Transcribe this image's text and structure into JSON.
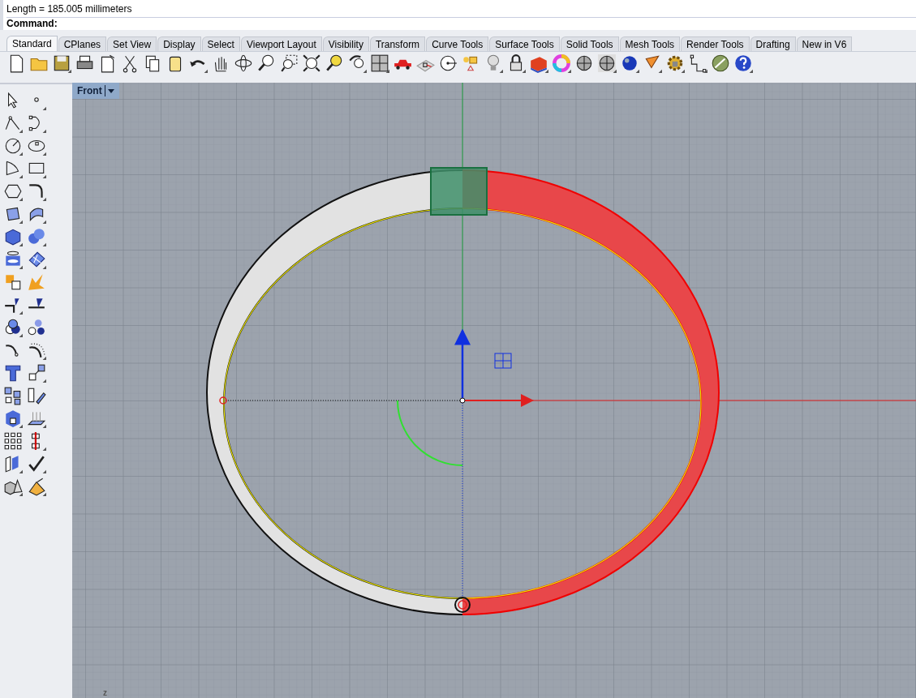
{
  "command_line": {
    "output": "Length = 185.005 millimeters",
    "prompt": "Command:"
  },
  "tabs": [
    {
      "label": "Standard",
      "selected": true
    },
    {
      "label": "CPlanes",
      "selected": false
    },
    {
      "label": "Set View",
      "selected": false
    },
    {
      "label": "Display",
      "selected": false
    },
    {
      "label": "Select",
      "selected": false
    },
    {
      "label": "Viewport Layout",
      "selected": false
    },
    {
      "label": "Visibility",
      "selected": false
    },
    {
      "label": "Transform",
      "selected": false
    },
    {
      "label": "Curve Tools",
      "selected": false
    },
    {
      "label": "Surface Tools",
      "selected": false
    },
    {
      "label": "Solid Tools",
      "selected": false
    },
    {
      "label": "Mesh Tools",
      "selected": false
    },
    {
      "label": "Render Tools",
      "selected": false
    },
    {
      "label": "Drafting",
      "selected": false
    },
    {
      "label": "New in V6",
      "selected": false
    }
  ],
  "viewport": {
    "title": "Front",
    "axis_label": "z"
  }
}
